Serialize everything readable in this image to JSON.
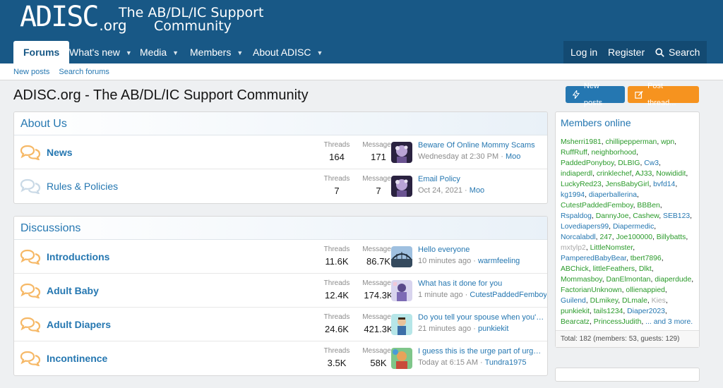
{
  "logo": {
    "main": "ADISC",
    "suffix": ".org",
    "tagline1": "The AB/DL/IC Support",
    "tagline2": "Community"
  },
  "nav": {
    "tabs": [
      {
        "label": "Forums"
      },
      {
        "label": "What's new"
      },
      {
        "label": "Media"
      },
      {
        "label": "Members"
      },
      {
        "label": "About ADISC"
      }
    ],
    "login": "Log in",
    "register": "Register",
    "search": "Search"
  },
  "subnav": {
    "new_posts": "New posts",
    "search_forums": "Search forums"
  },
  "page": {
    "title": "ADISC.org - The AB/DL/IC Support Community",
    "new_posts_btn": "New posts",
    "post_thread_btn": "Post thread..."
  },
  "labels": {
    "threads": "Threads",
    "messages": "Messages"
  },
  "categories": [
    {
      "title": "About Us",
      "forums": [
        {
          "name": "News",
          "threads": "164",
          "messages": "171",
          "last_title": "Beware Of Online Mommy Scams",
          "last_time": "Wednesday at 2:30 PM",
          "last_user": "Moo"
        },
        {
          "name": "Rules & Policies",
          "threads": "7",
          "messages": "7",
          "last_title": "Email Policy",
          "last_time": "Oct 24, 2021",
          "last_user": "Moo"
        }
      ]
    },
    {
      "title": "Discussions",
      "forums": [
        {
          "name": "Introductions",
          "threads": "11.6K",
          "messages": "86.7K",
          "last_title": "Hello everyone",
          "last_time": "10 minutes ago",
          "last_user": "warmfeeling"
        },
        {
          "name": "Adult Baby",
          "threads": "12.4K",
          "messages": "174.3K",
          "last_title": "What has it done for you",
          "last_time": "1 minute ago",
          "last_user": "CutestPaddedFemboy"
        },
        {
          "name": "Adult Diapers",
          "threads": "24.6K",
          "messages": "421.3K",
          "last_title": "Do you tell your spouse when you're...",
          "last_time": "21 minutes ago",
          "last_user": "punkiekit"
        },
        {
          "name": "Incontinence",
          "threads": "3.5K",
          "messages": "58K",
          "last_title": "I guess this is the urge part of urge ...",
          "last_time": "Today at 6:15 AM",
          "last_user": "Tundra1975"
        }
      ]
    }
  ],
  "sidebar": {
    "title": "Members online",
    "members": [
      {
        "n": "Msherri1981",
        "c": "m"
      },
      {
        "n": "chillipepperman",
        "c": "m"
      },
      {
        "n": "wpn",
        "c": "m"
      },
      {
        "n": "RuffRuff",
        "c": "m"
      },
      {
        "n": "neighborhood",
        "c": "m"
      },
      {
        "n": "PaddedPonyboy",
        "c": "m"
      },
      {
        "n": "DLBIG",
        "c": "m"
      },
      {
        "n": "Cw3",
        "c": "b"
      },
      {
        "n": "indiaperdl",
        "c": "m"
      },
      {
        "n": "crinklechef",
        "c": "m"
      },
      {
        "n": "AJ33",
        "c": "m"
      },
      {
        "n": "Nowididit",
        "c": "m"
      },
      {
        "n": "LuckyRed23",
        "c": "m"
      },
      {
        "n": "JensBabyGirl",
        "c": "m"
      },
      {
        "n": "bvfd14",
        "c": "b"
      },
      {
        "n": "kg1994",
        "c": "b"
      },
      {
        "n": "diaperballerina",
        "c": "b"
      },
      {
        "n": "CutestPaddedFemboy",
        "c": "m"
      },
      {
        "n": "BBBen",
        "c": "m"
      },
      {
        "n": "Rspaldog",
        "c": "b"
      },
      {
        "n": "DannyJoe",
        "c": "m"
      },
      {
        "n": "Cashew",
        "c": "m"
      },
      {
        "n": "SEB123",
        "c": "b"
      },
      {
        "n": "Lovediapers99",
        "c": "b"
      },
      {
        "n": "Diapermedic",
        "c": "b"
      },
      {
        "n": "Norcalabdl",
        "c": "b"
      },
      {
        "n": "247",
        "c": "m"
      },
      {
        "n": "Joe100000",
        "c": "m"
      },
      {
        "n": "Billybatts",
        "c": "m"
      },
      {
        "n": "mxtylp2",
        "c": "g"
      },
      {
        "n": "LittleNomster",
        "c": "m"
      },
      {
        "n": "PamperedBabyBear",
        "c": "b"
      },
      {
        "n": "tbert7896",
        "c": "m"
      },
      {
        "n": "ABChick",
        "c": "m"
      },
      {
        "n": "littleFeathers",
        "c": "m"
      },
      {
        "n": "Dlkt",
        "c": "m"
      },
      {
        "n": "Mommasboy",
        "c": "m"
      },
      {
        "n": "DanElmontan",
        "c": "m"
      },
      {
        "n": "diaperdude",
        "c": "m"
      },
      {
        "n": "FactorianUnknown",
        "c": "m"
      },
      {
        "n": "ollienappied",
        "c": "m"
      },
      {
        "n": "Guilend",
        "c": "b"
      },
      {
        "n": "DLmikey",
        "c": "m"
      },
      {
        "n": "DLmale",
        "c": "m"
      },
      {
        "n": "Kies",
        "c": "g"
      },
      {
        "n": "punkiekit",
        "c": "m"
      },
      {
        "n": "tails1234",
        "c": "m"
      },
      {
        "n": "Diaper2023",
        "c": "b"
      },
      {
        "n": "Bearcatz",
        "c": "m"
      },
      {
        "n": "PrincessJudith",
        "c": "m"
      }
    ],
    "more": "... and 3 more.",
    "footer": "Total: 182 (members: 53, guests: 129)"
  },
  "colors": {
    "header": "#185886",
    "link": "#2577b1",
    "accent_orange": "#f6931f",
    "online_green": "#2a9a2a"
  }
}
